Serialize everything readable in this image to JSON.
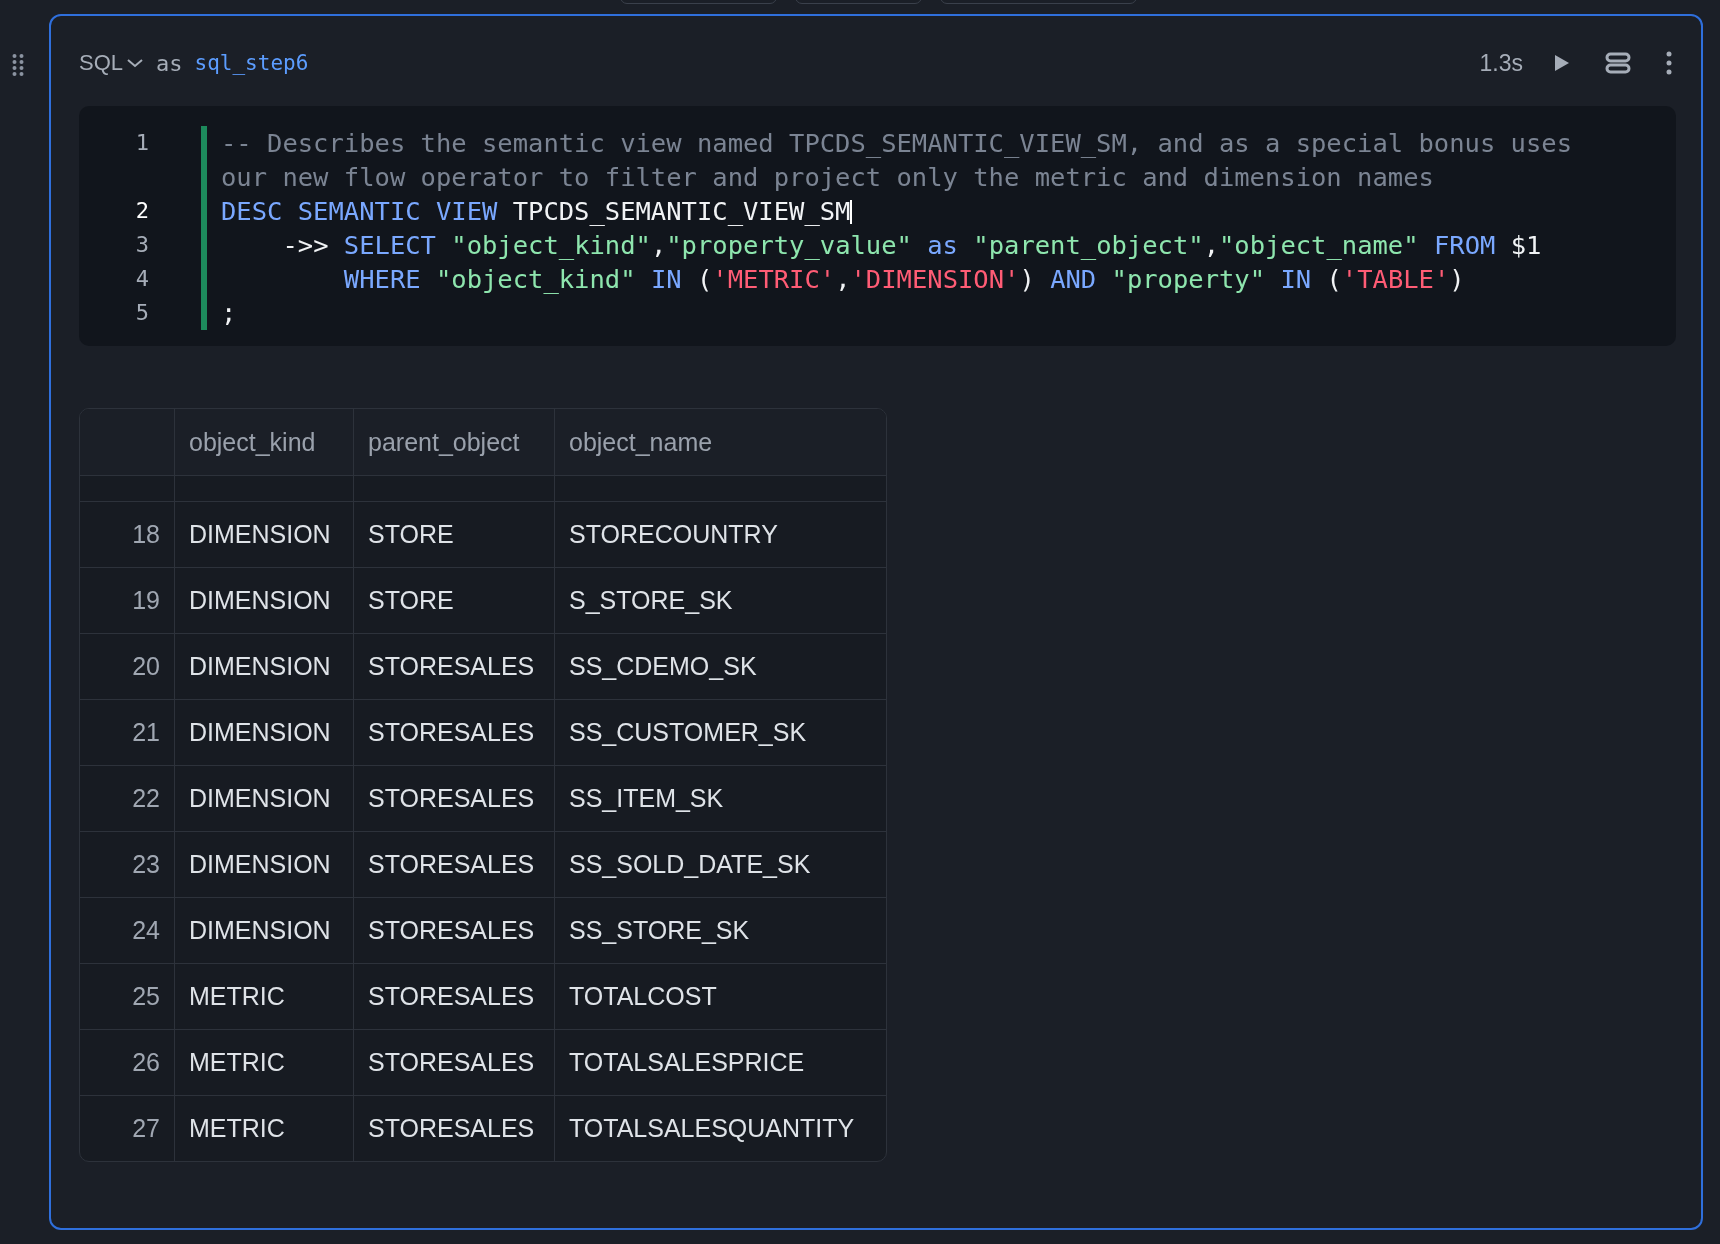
{
  "cell": {
    "language": "SQL",
    "as_label": "as",
    "name": "sql_step6",
    "duration": "1.3s"
  },
  "code": [
    {
      "number": "1",
      "active": false,
      "tokens": [
        {
          "kind": "comment",
          "text": "-- Describes the semantic view named TPCDS_SEMANTIC_VIEW_SM, and as a special bonus uses our new flow operator to filter and project only the metric and dimension names"
        }
      ]
    },
    {
      "number": "2",
      "active": true,
      "tokens": [
        {
          "kind": "keyword",
          "text": "DESC SEMANTIC VIEW "
        },
        {
          "kind": "plain",
          "text": "TPCDS_SEMANTIC_VIEW_SM"
        }
      ]
    },
    {
      "number": "3",
      "active": false,
      "tokens": [
        {
          "kind": "plain",
          "text": "    ->> "
        },
        {
          "kind": "keyword",
          "text": "SELECT "
        },
        {
          "kind": "string",
          "text": "\"object_kind\""
        },
        {
          "kind": "plain",
          "text": ","
        },
        {
          "kind": "string",
          "text": "\"property_value\""
        },
        {
          "kind": "keyword",
          "text": " as "
        },
        {
          "kind": "string",
          "text": "\"parent_object\""
        },
        {
          "kind": "plain",
          "text": ","
        },
        {
          "kind": "string",
          "text": "\"object_name\""
        },
        {
          "kind": "keyword",
          "text": " FROM "
        },
        {
          "kind": "plain",
          "text": "$1"
        }
      ]
    },
    {
      "number": "4",
      "active": false,
      "tokens": [
        {
          "kind": "keyword",
          "text": "        WHERE "
        },
        {
          "kind": "string",
          "text": "\"object_kind\""
        },
        {
          "kind": "keyword",
          "text": " IN "
        },
        {
          "kind": "plain",
          "text": "("
        },
        {
          "kind": "literal",
          "text": "'METRIC'"
        },
        {
          "kind": "plain",
          "text": ","
        },
        {
          "kind": "literal",
          "text": "'DIMENSION'"
        },
        {
          "kind": "plain",
          "text": ") "
        },
        {
          "kind": "keyword",
          "text": "AND "
        },
        {
          "kind": "string",
          "text": "\"property\""
        },
        {
          "kind": "keyword",
          "text": " IN "
        },
        {
          "kind": "plain",
          "text": "("
        },
        {
          "kind": "literal",
          "text": "'TABLE'"
        },
        {
          "kind": "plain",
          "text": ")"
        }
      ]
    },
    {
      "number": "5",
      "active": false,
      "tokens": [
        {
          "kind": "plain",
          "text": ";"
        }
      ]
    }
  ],
  "table": {
    "columns": [
      "object_kind",
      "parent_object",
      "object_name"
    ],
    "rows": [
      {
        "index": "18",
        "cells": [
          "DIMENSION",
          "STORE",
          "STORECOUNTRY"
        ]
      },
      {
        "index": "19",
        "cells": [
          "DIMENSION",
          "STORE",
          "S_STORE_SK"
        ]
      },
      {
        "index": "20",
        "cells": [
          "DIMENSION",
          "STORESALES",
          "SS_CDEMO_SK"
        ]
      },
      {
        "index": "21",
        "cells": [
          "DIMENSION",
          "STORESALES",
          "SS_CUSTOMER_SK"
        ]
      },
      {
        "index": "22",
        "cells": [
          "DIMENSION",
          "STORESALES",
          "SS_ITEM_SK"
        ]
      },
      {
        "index": "23",
        "cells": [
          "DIMENSION",
          "STORESALES",
          "SS_SOLD_DATE_SK"
        ]
      },
      {
        "index": "24",
        "cells": [
          "DIMENSION",
          "STORESALES",
          "SS_STORE_SK"
        ]
      },
      {
        "index": "25",
        "cells": [
          "METRIC",
          "STORESALES",
          "TOTALCOST"
        ]
      },
      {
        "index": "26",
        "cells": [
          "METRIC",
          "STORESALES",
          "TOTALSALESPRICE"
        ]
      },
      {
        "index": "27",
        "cells": [
          "METRIC",
          "STORESALES",
          "TOTALSALESQUANTITY"
        ]
      }
    ]
  }
}
